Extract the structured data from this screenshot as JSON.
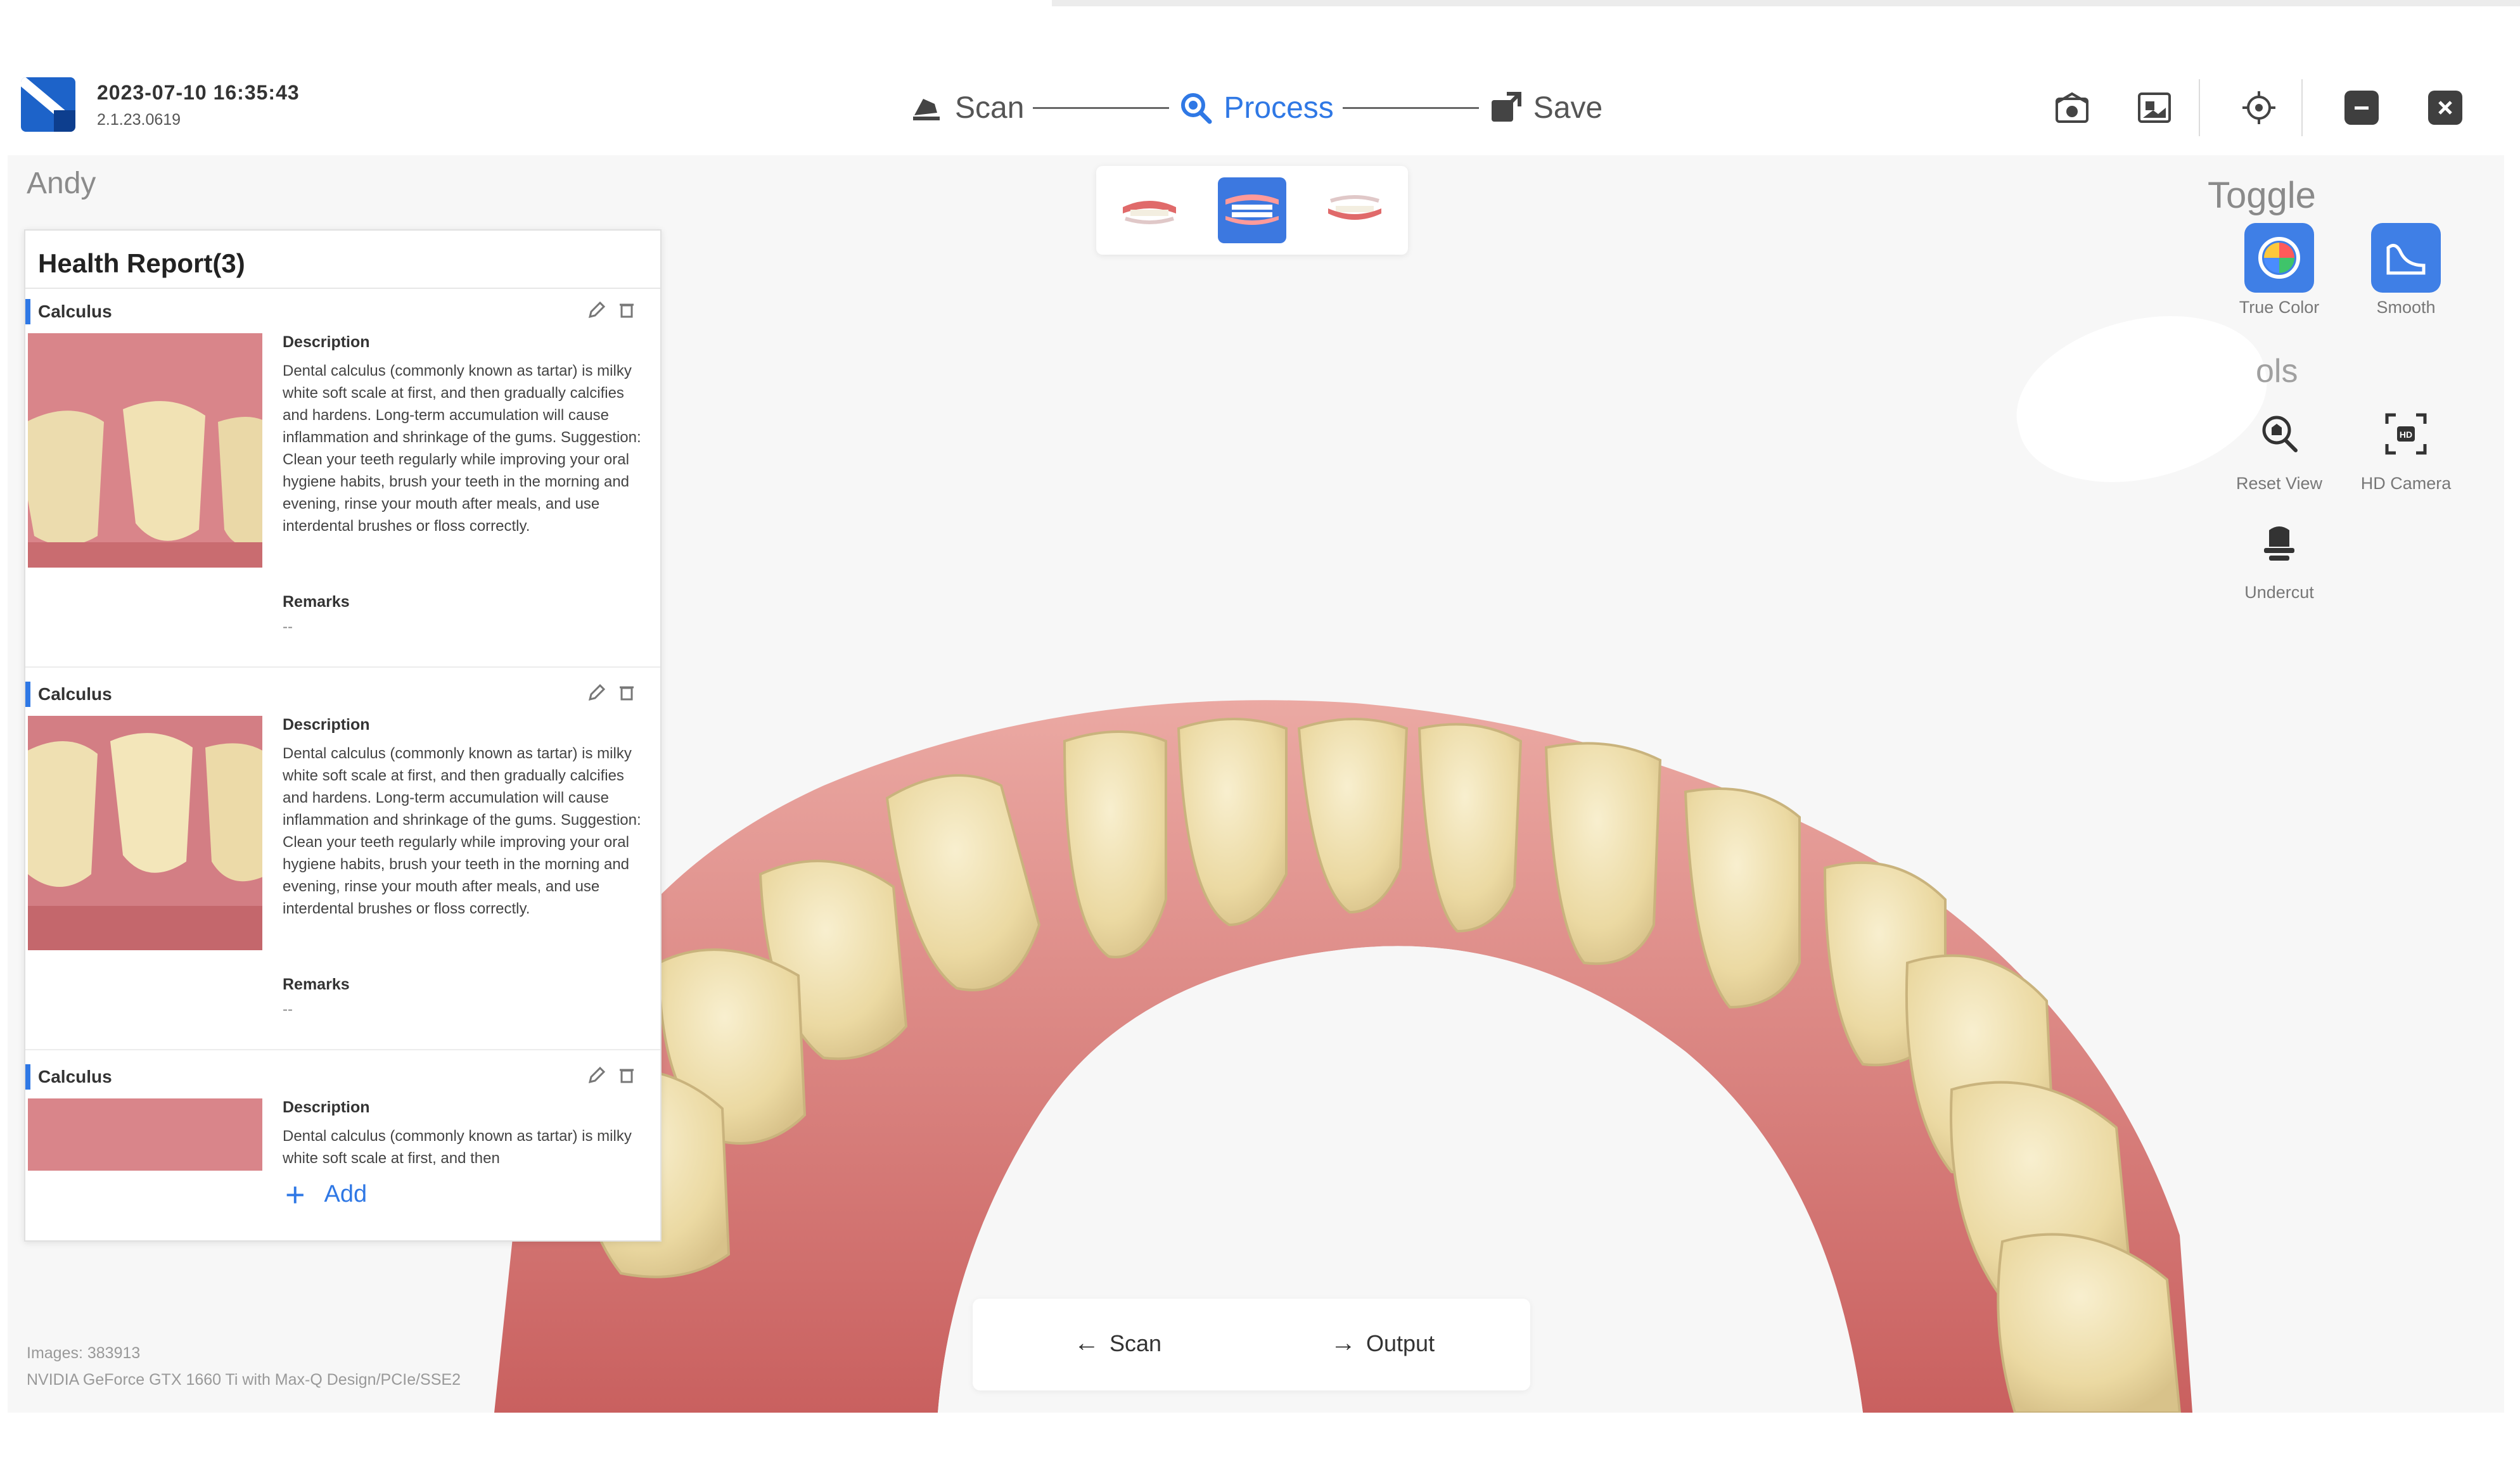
{
  "header": {
    "datetime": "2023-07-10 16:35:43",
    "version": "2.1.23.0619",
    "steps": [
      {
        "label": "Scan",
        "icon": "scan-icon",
        "active": false
      },
      {
        "label": "Process",
        "icon": "process-icon",
        "active": true
      },
      {
        "label": "Save",
        "icon": "save-icon",
        "active": false
      }
    ],
    "window_icons": [
      "camera-icon",
      "image-icon",
      "target-icon",
      "minimize-icon",
      "close-icon"
    ]
  },
  "patient": {
    "name": "Andy"
  },
  "jaw_selector": {
    "options": [
      "upper-jaw-icon",
      "both-jaws-icon",
      "lower-jaw-icon"
    ],
    "selected": 1
  },
  "toggle_panel": {
    "title": "Toggle",
    "items": [
      {
        "label": "True Color",
        "icon": "color-wheel-icon"
      },
      {
        "label": "Smooth",
        "icon": "smooth-icon"
      }
    ]
  },
  "tools_panel": {
    "title": "ols",
    "items": [
      {
        "label": "Reset View",
        "icon": "reset-view-icon"
      },
      {
        "label": "HD Camera",
        "icon": "hd-camera-icon"
      },
      {
        "label": "Undercut",
        "icon": "undercut-icon"
      }
    ]
  },
  "health_report": {
    "title": "Health Report(3)",
    "entries": [
      {
        "category": "Calculus",
        "description_heading": "Description",
        "description": "Dental calculus (commonly known as tartar) is milky white soft scale at first, and then gradually calcifies and hardens. Long-term accumulation will cause inflammation and shrinkage of the gums. Suggestion: Clean your teeth regularly while improving your oral hygiene habits, brush your teeth in the morning and evening, rinse your mouth after meals, and use interdental brushes or floss correctly.",
        "remarks_heading": "Remarks",
        "remarks": "--"
      },
      {
        "category": "Calculus",
        "description_heading": "Description",
        "description": "Dental calculus (commonly known as tartar) is milky white soft scale at first, and then gradually calcifies and hardens. Long-term accumulation will cause inflammation and shrinkage of the gums. Suggestion: Clean your teeth regularly while improving your oral hygiene habits, brush your teeth in the morning and evening, rinse your mouth after meals, and use interdental brushes or floss correctly.",
        "remarks_heading": "Remarks",
        "remarks": "--"
      },
      {
        "category": "Calculus",
        "description_heading": "Description",
        "description": "Dental calculus (commonly known as tartar) is milky white soft scale at first, and then",
        "remarks_heading": "",
        "remarks": ""
      }
    ],
    "add_label": "Add"
  },
  "footer": {
    "images": "Images: 383913",
    "gpu": "NVIDIA GeForce GTX 1660 Ti with Max-Q Design/PCIe/SSE2"
  },
  "bottom_nav": {
    "back_label": "Scan",
    "next_label": "Output"
  },
  "colors": {
    "accent": "#2f78e5",
    "header_bg": "#ffffff",
    "canvas_bg": "#f7f7f7",
    "gum": "#d9858a",
    "tooth": "#efe1b2"
  }
}
